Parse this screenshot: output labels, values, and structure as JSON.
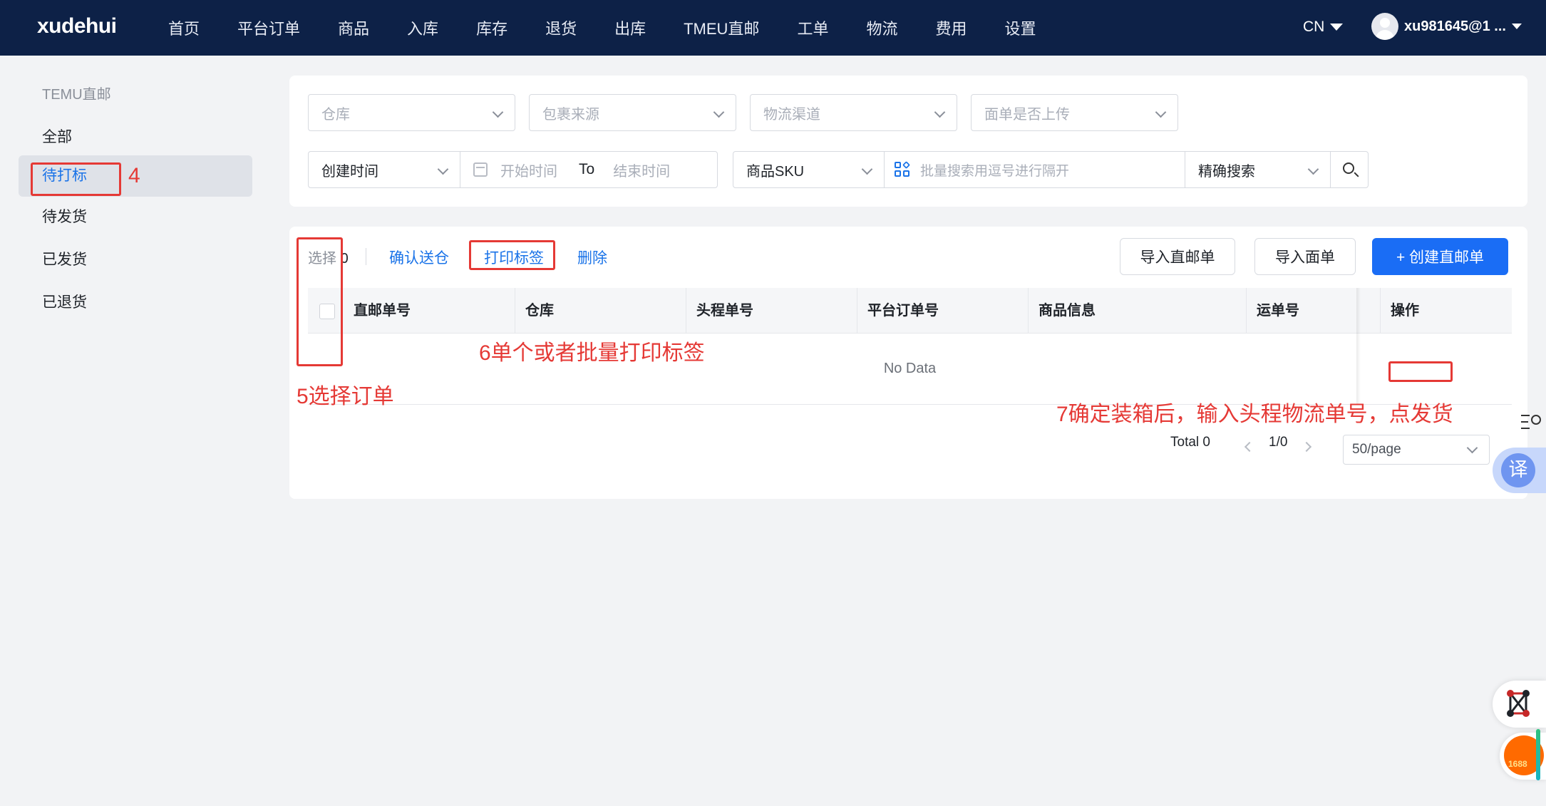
{
  "app": {
    "logo": "xudehui"
  },
  "nav": {
    "items": [
      "首页",
      "平台订单",
      "商品",
      "入库",
      "库存",
      "退货",
      "出库",
      "TMEU直邮",
      "工单",
      "物流",
      "费用",
      "设置"
    ],
    "language": "CN",
    "user": "xu981645@1 ..."
  },
  "sidebar": {
    "title": "TEMU直邮",
    "items": [
      "全部",
      "待打标",
      "待发货",
      "已发货",
      "已退货"
    ],
    "active": "待打标"
  },
  "filters": {
    "warehouse_placeholder": "仓库",
    "package_source_placeholder": "包裹来源",
    "logistics_channel_placeholder": "物流渠道",
    "label_uploaded_placeholder": "面单是否上传",
    "time_type": "创建时间",
    "start_time_placeholder": "开始时间",
    "to_label": "To",
    "end_time_placeholder": "结束时间",
    "search_field": "商品SKU",
    "batch_search_placeholder": "批量搜索用逗号进行隔开",
    "search_mode": "精确搜索"
  },
  "toolbar": {
    "selected_label": "选择",
    "selected_count": "0",
    "confirm_send": "确认送仓",
    "print_label": "打印标签",
    "delete": "删除",
    "import_direct": "导入直邮单",
    "import_label": "导入面单",
    "create_direct": "+ 创建直邮单"
  },
  "table": {
    "columns": [
      "直邮单号",
      "仓库",
      "头程单号",
      "平台订单号",
      "商品信息",
      "运单号",
      "操作"
    ],
    "empty_text": "No Data"
  },
  "pagination": {
    "total": "Total 0",
    "page": "1/0",
    "page_size": "50/page"
  },
  "annotations": {
    "step4": "4",
    "step5": "5选择订单",
    "step6": "6单个或者批量打印标签",
    "step7": "7确定装箱后，输入头程物流单号，点发货"
  },
  "floating": {
    "translate_glyph": "译",
    "alibaba_label": "1688"
  },
  "colors": {
    "topbar": "#0d2147",
    "accent": "#1a6df5",
    "annotation": "#e53935",
    "active_bg": "#dfe2e8"
  }
}
